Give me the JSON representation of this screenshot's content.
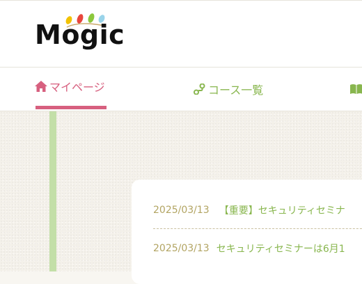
{
  "header": {
    "logo_text": "Mogic",
    "logo_colors": [
      "#f2c200",
      "#e8463c",
      "#8cc83c",
      "#9ad4ea"
    ]
  },
  "nav": {
    "items": [
      {
        "label": "マイページ",
        "icon": "home-icon",
        "active": true
      },
      {
        "label": "コース一覧",
        "icon": "route-icon",
        "active": false
      },
      {
        "label": "",
        "icon": "book-icon",
        "active": false
      }
    ],
    "active_color": "#d7607f",
    "inactive_color": "#88b64e"
  },
  "news": {
    "items": [
      {
        "date": "2025/03/13",
        "title": "【重要】セキュリティセミナ"
      },
      {
        "date": "2025/03/13",
        "title": "セキュリティセミナーは6月1"
      }
    ]
  }
}
